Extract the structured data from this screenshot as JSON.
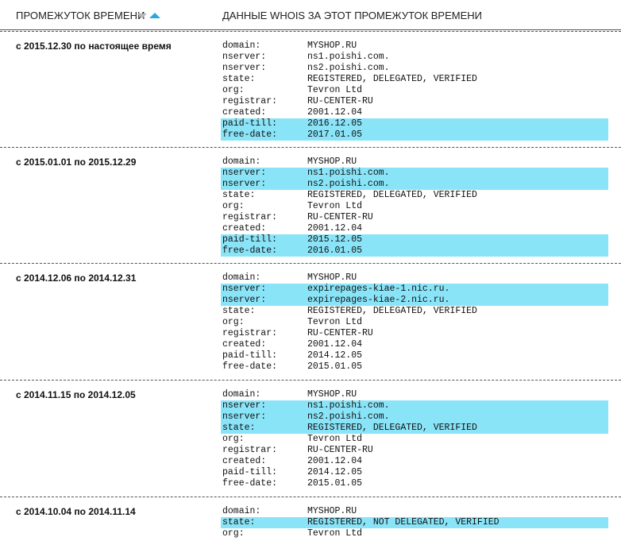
{
  "header": {
    "period_label": "ПРОМЕЖУТОК ВРЕМЕНИ",
    "whois_label": "ДАННЫЕ WHOIS ЗА ЭТОТ ПРОМЕЖУТОК ВРЕМЕНИ"
  },
  "colors": {
    "highlight": "#8ae4f8",
    "sort_active": "#2aa6e0",
    "sort_inactive": "#b8b8b8"
  },
  "records": [
    {
      "period": "с 2015.12.30 по настоящее время",
      "lines": [
        {
          "k": "domain:",
          "v": "MYSHOP.RU",
          "hl": false
        },
        {
          "k": "nserver:",
          "v": "ns1.poishi.com.",
          "hl": false
        },
        {
          "k": "nserver:",
          "v": "ns2.poishi.com.",
          "hl": false
        },
        {
          "k": "state:",
          "v": "REGISTERED, DELEGATED, VERIFIED",
          "hl": false
        },
        {
          "k": "org:",
          "v": "Tevron Ltd",
          "hl": false
        },
        {
          "k": "registrar:",
          "v": "RU-CENTER-RU",
          "hl": false
        },
        {
          "k": "created:",
          "v": "2001.12.04",
          "hl": false
        },
        {
          "k": "paid-till:",
          "v": "2016.12.05",
          "hl": true
        },
        {
          "k": "free-date:",
          "v": "2017.01.05",
          "hl": true
        }
      ]
    },
    {
      "period": "с 2015.01.01 по 2015.12.29",
      "lines": [
        {
          "k": "domain:",
          "v": "MYSHOP.RU",
          "hl": false
        },
        {
          "k": "nserver:",
          "v": "ns1.poishi.com.",
          "hl": true
        },
        {
          "k": "nserver:",
          "v": "ns2.poishi.com.",
          "hl": true
        },
        {
          "k": "state:",
          "v": "REGISTERED, DELEGATED, VERIFIED",
          "hl": false
        },
        {
          "k": "org:",
          "v": "Tevron Ltd",
          "hl": false
        },
        {
          "k": "registrar:",
          "v": "RU-CENTER-RU",
          "hl": false
        },
        {
          "k": "created:",
          "v": "2001.12.04",
          "hl": false
        },
        {
          "k": "paid-till:",
          "v": "2015.12.05",
          "hl": true
        },
        {
          "k": "free-date:",
          "v": "2016.01.05",
          "hl": true
        }
      ]
    },
    {
      "period": "с 2014.12.06 по 2014.12.31",
      "lines": [
        {
          "k": "domain:",
          "v": "MYSHOP.RU",
          "hl": false
        },
        {
          "k": "nserver:",
          "v": "expirepages-kiae-1.nic.ru.",
          "hl": true
        },
        {
          "k": "nserver:",
          "v": "expirepages-kiae-2.nic.ru.",
          "hl": true
        },
        {
          "k": "state:",
          "v": "REGISTERED, DELEGATED, VERIFIED",
          "hl": false
        },
        {
          "k": "org:",
          "v": "Tevron Ltd",
          "hl": false
        },
        {
          "k": "registrar:",
          "v": "RU-CENTER-RU",
          "hl": false
        },
        {
          "k": "created:",
          "v": "2001.12.04",
          "hl": false
        },
        {
          "k": "paid-till:",
          "v": "2014.12.05",
          "hl": false
        },
        {
          "k": "free-date:",
          "v": "2015.01.05",
          "hl": false
        }
      ]
    },
    {
      "period": "с 2014.11.15 по 2014.12.05",
      "lines": [
        {
          "k": "domain:",
          "v": "MYSHOP.RU",
          "hl": false
        },
        {
          "k": "nserver:",
          "v": "ns1.poishi.com.",
          "hl": true
        },
        {
          "k": "nserver:",
          "v": "ns2.poishi.com.",
          "hl": true
        },
        {
          "k": "state:",
          "v": "REGISTERED, DELEGATED, VERIFIED",
          "hl": true
        },
        {
          "k": "org:",
          "v": "Tevron Ltd",
          "hl": false
        },
        {
          "k": "registrar:",
          "v": "RU-CENTER-RU",
          "hl": false
        },
        {
          "k": "created:",
          "v": "2001.12.04",
          "hl": false
        },
        {
          "k": "paid-till:",
          "v": "2014.12.05",
          "hl": false
        },
        {
          "k": "free-date:",
          "v": "2015.01.05",
          "hl": false
        }
      ]
    },
    {
      "period": "с 2014.10.04 по 2014.11.14",
      "lines": [
        {
          "k": "domain:",
          "v": "MYSHOP.RU",
          "hl": false
        },
        {
          "k": "state:",
          "v": "REGISTERED, NOT DELEGATED, VERIFIED",
          "hl": true
        },
        {
          "k": "org:",
          "v": "Tevron Ltd",
          "hl": false
        }
      ]
    }
  ]
}
